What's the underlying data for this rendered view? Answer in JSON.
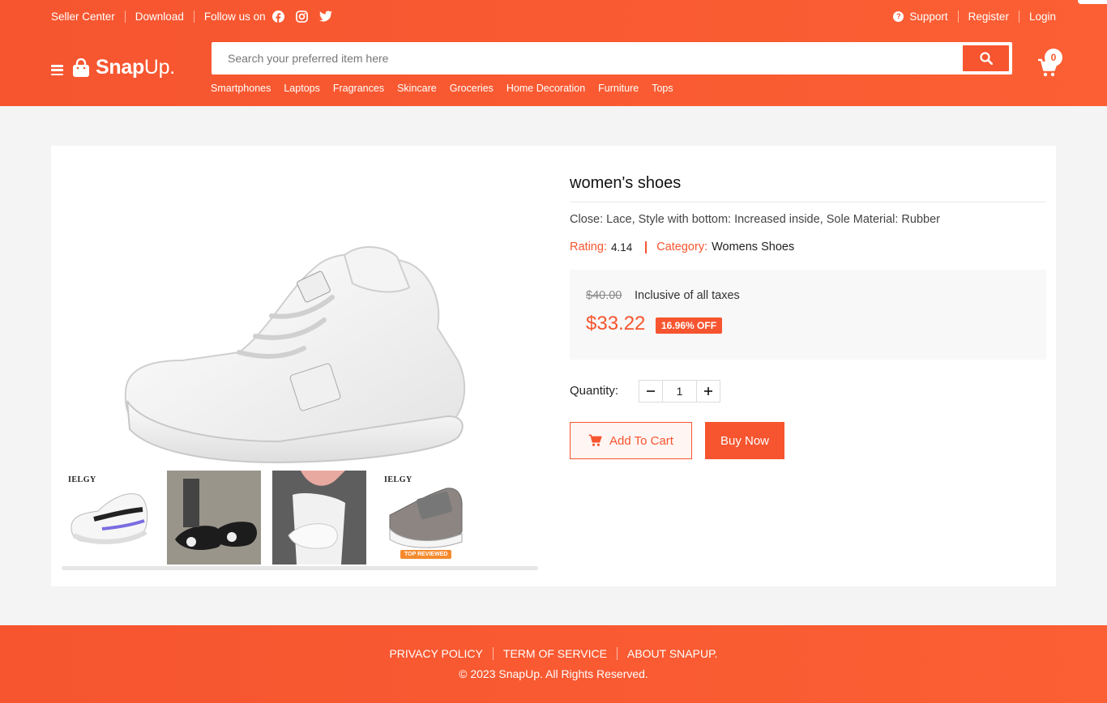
{
  "topbar": {
    "seller_center": "Seller Center",
    "download": "Download",
    "follow_us": "Follow us on",
    "support": "Support",
    "register": "Register",
    "login": "Login"
  },
  "brand": {
    "name_bold": "Snap",
    "name_thin": "Up."
  },
  "search": {
    "placeholder": "Search your preferred item here"
  },
  "categories": [
    "Smartphones",
    "Laptops",
    "Fragrances",
    "Skincare",
    "Groceries",
    "Home Decoration",
    "Furniture",
    "Tops"
  ],
  "cart": {
    "count": "0"
  },
  "product": {
    "title": "women's shoes",
    "description": "Close: Lace, Style with bottom: Increased inside, Sole Material: Rubber",
    "rating_label": "Rating:",
    "rating": "4.14",
    "category_label": "Category:",
    "category": "Womens Shoes",
    "old_price": "$40.00",
    "tax_note": "Inclusive of all taxes",
    "price": "$33.22",
    "discount": "16.96% OFF",
    "quantity_label": "Quantity:",
    "quantity": "1",
    "add_to_cart": "Add To Cart",
    "buy_now": "Buy Now",
    "thumbnails": [
      {
        "brand": "IELGY",
        "badge": ""
      },
      {
        "brand": "",
        "badge": ""
      },
      {
        "brand": "",
        "badge": ""
      },
      {
        "brand": "IELGY",
        "badge": "TOP REVIEWED"
      }
    ]
  },
  "footer": {
    "privacy": "PRIVACY POLICY",
    "terms": "TERM OF SERVICE",
    "about": "ABOUT SNAPUP.",
    "copyright": "© 2023 SnapUp. All Rights Reserved."
  },
  "colors": {
    "accent": "#f6552f",
    "page_bg": "#f4f4f4"
  }
}
